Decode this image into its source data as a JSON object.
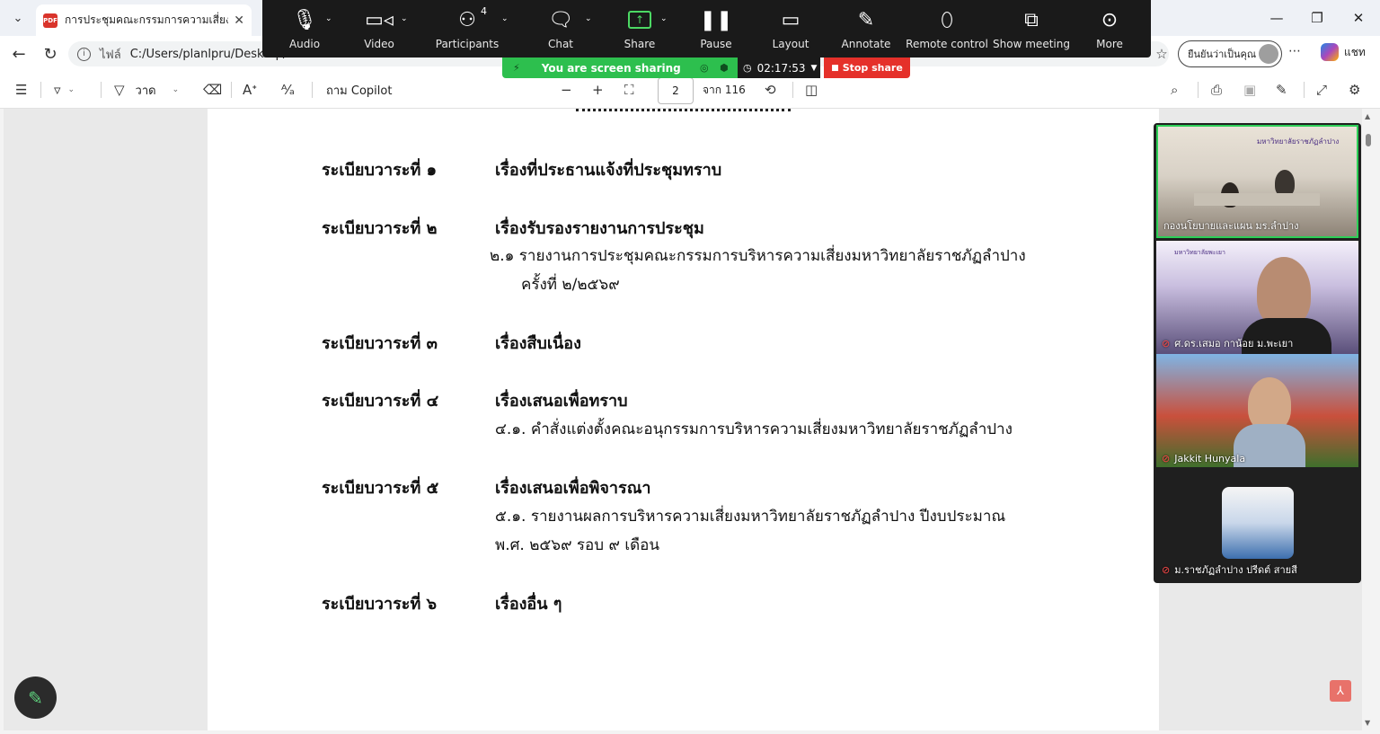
{
  "browser": {
    "tab_title": "การประชุมคณะกรรมการความเสี่ยง ครั้งที่",
    "url_prefix": "ไฟล์",
    "url": "C:/Users/planlpru/Desktop/",
    "profile_label": "ยืนยันว่าเป็นคุณ",
    "chat_label": "แชท"
  },
  "pdf_toolbar": {
    "draw_label": "วาด",
    "copilot_label": "ถาม Copilot",
    "page_number": "2",
    "page_total": "จาก 116"
  },
  "zoom_toolbar": {
    "buttons": [
      {
        "label": "Audio",
        "icon": "microphone-icon"
      },
      {
        "label": "Video",
        "icon": "video-camera-icon"
      },
      {
        "label": "Participants",
        "icon": "participants-icon"
      },
      {
        "label": "Chat",
        "icon": "chat-bubble-icon"
      },
      {
        "label": "Share",
        "icon": "share-screen-icon"
      },
      {
        "label": "Pause",
        "icon": "pause-icon"
      },
      {
        "label": "Layout",
        "icon": "layout-icon"
      },
      {
        "label": "Annotate",
        "icon": "pencil-icon"
      },
      {
        "label": "Remote control",
        "icon": "mouse-icon"
      },
      {
        "label": "Show meeting",
        "icon": "show-meeting-icon"
      },
      {
        "label": "More",
        "icon": "more-icon"
      }
    ],
    "participant_count": "4",
    "sharing_status": "You are screen sharing",
    "timer": "02:17:53",
    "stop_share_label": "Stop share",
    "share_color": "#2dbf4e",
    "stop_color": "#e5302a"
  },
  "document": {
    "agenda": [
      {
        "label": "ระเบียบวาระที่ ๑",
        "title": "เรื่องที่ประธานแจ้งที่ประชุมทราบ",
        "items": []
      },
      {
        "label": "ระเบียบวาระที่ ๒",
        "title": "เรื่องรับรองรายงานการประชุม",
        "items": [
          "๒.๑ รายงานการประชุมคณะกรรมการบริหารความเสี่ยงมหาวิทยาลัยราชภัฏลำปาง",
          "ครั้งที่ ๒/๒๕๖๙"
        ]
      },
      {
        "label": "ระเบียบวาระที่ ๓",
        "title": "เรื่องสืบเนื่อง",
        "items": []
      },
      {
        "label": "ระเบียบวาระที่ ๔",
        "title": "เรื่องเสนอเพื่อทราบ",
        "items": [
          "๔.๑. คำสั่งแต่งตั้งคณะอนุกรรมการบริหารความเสี่ยงมหาวิทยาลัยราชภัฏลำปาง"
        ]
      },
      {
        "label": "ระเบียบวาระที่ ๕",
        "title": "เรื่องเสนอเพื่อพิจารณา",
        "items": [
          "๕.๑. รายงานผลการบริหารความเสี่ยงมหาวิทยาลัยราชภัฏลำปาง ปีงบประมาณ",
          "พ.ศ. ๒๕๖๙ รอบ ๙ เดือน"
        ]
      },
      {
        "label": "ระเบียบวาระที่ ๖",
        "title": "เรื่องอื่น ๆ",
        "items": []
      }
    ]
  },
  "video_panel": {
    "tiles": [
      {
        "name": "กองนโยบายและแผน มร.ลำปาง",
        "muted": false,
        "banner": "มหาวิทยาลัยราชภัฏลำปาง"
      },
      {
        "name": "ศ.ดร.เสมอ กาน้อย ม.พะเยา",
        "muted": true,
        "banner": "มหาวิทยาลัยพะเยา"
      },
      {
        "name": "Jakkit Hunyala",
        "muted": true
      },
      {
        "name": "ม.ราชภัฏลำปาง ปรีดต์ สายสี",
        "muted": true
      }
    ]
  }
}
